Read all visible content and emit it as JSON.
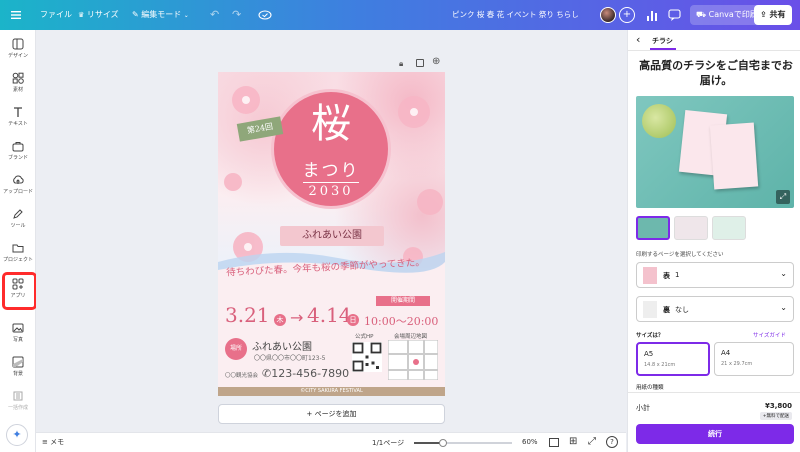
{
  "topbar": {
    "file": "ファイル",
    "resize": "リサイズ",
    "edit_mode": "編集モード",
    "design_title": "ピンク 桜 春 花 イベント 祭り ちらし",
    "print_label": "Canvaで印刷",
    "share_label": "共有"
  },
  "sidebar": {
    "items": [
      {
        "label": "デザイン",
        "icon": "layout-icon"
      },
      {
        "label": "素材",
        "icon": "elements-icon"
      },
      {
        "label": "テキスト",
        "icon": "text-icon"
      },
      {
        "label": "ブランド",
        "icon": "brand-icon"
      },
      {
        "label": "アップロード",
        "icon": "upload-icon"
      },
      {
        "label": "ツール",
        "icon": "draw-icon"
      },
      {
        "label": "プロジェクト",
        "icon": "folder-icon"
      },
      {
        "label": "アプリ",
        "icon": "apps-icon"
      },
      {
        "label": "写真",
        "icon": "photo-icon"
      },
      {
        "label": "背景",
        "icon": "background-icon"
      },
      {
        "label": "一括作成",
        "icon": "bulk-icon"
      }
    ]
  },
  "poster": {
    "badge": "第24回",
    "title_main": "桜",
    "title_sub": "まつり",
    "year": "2030",
    "venue_ribbon": "ふれあい公園",
    "tagline": "待ちわびた春。今年も桜の季節がやってきた。",
    "period_label": "開催期間",
    "date_start": "3.21",
    "day_start": "木",
    "date_end": "4.14",
    "day_end": "日",
    "time": "10:00〜20:00",
    "place_tag": "場所",
    "place_name": "ふれあい公園",
    "address": "〇〇県〇〇市〇〇町123-5",
    "organizer": "〇〇観光協会",
    "phone": "123-456-7890",
    "site_label": "公式HP",
    "map_label": "会場周辺地図",
    "footer": "©CITY SAKURA FESTIVAL"
  },
  "canvas": {
    "add_page": "+ ページを追加"
  },
  "bottombar": {
    "notes": "メモ",
    "page_indicator": "1/1ページ",
    "zoom": "60%",
    "zoom_fraction": 0.3
  },
  "panel": {
    "tab": "チラシ",
    "heading": "高品質のチラシをご自宅までお届け。",
    "select_pages_label": "印刷するページを選択してください",
    "front_label": "表",
    "front_value": "1",
    "back_label": "裏",
    "back_value": "なし",
    "size_label": "サイズは？",
    "size_guide": "サイズガイド",
    "sizes": [
      {
        "name": "A5",
        "dims": "14.8 x 21cm"
      },
      {
        "name": "A4",
        "dims": "21 x 29.7cm"
      }
    ],
    "paper_label": "用紙の種類",
    "subtotal_label": "小計",
    "subtotal_value": "¥3,800",
    "free_shipping": "+無料で配送",
    "continue_label": "続行"
  },
  "colors": {
    "accent_purple": "#7d2ae8",
    "highlight_red": "#ff2b2b",
    "poster_pink": "#e8708a",
    "poster_green": "#8fa77a"
  }
}
